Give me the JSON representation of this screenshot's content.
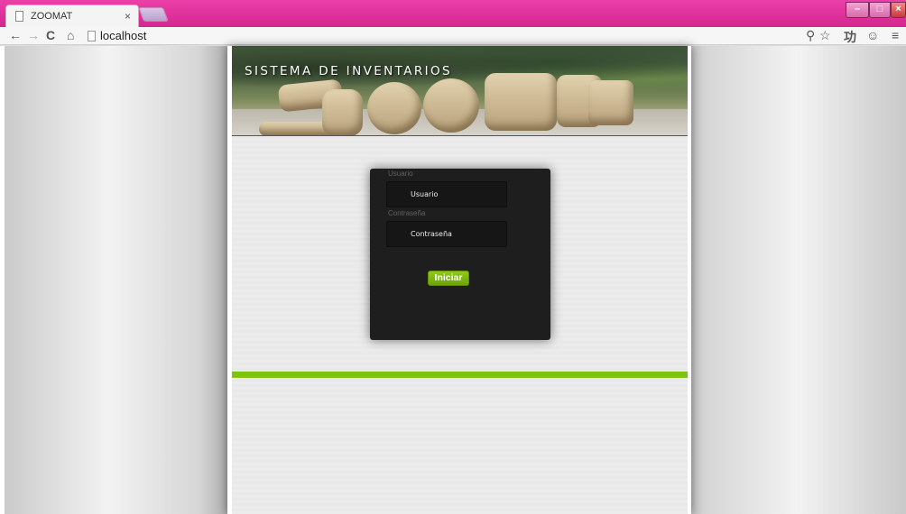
{
  "browser": {
    "tab_title": "ZOOMAT",
    "tab_close": "×",
    "url": "localhost",
    "nav": {
      "back": "←",
      "forward": "→",
      "reload": "C",
      "home": "⌂"
    },
    "toolbar_icons": {
      "zoom": "⚲",
      "star": "☆",
      "ext1": "功",
      "ext2": "☺",
      "menu": "≡"
    },
    "window_controls": {
      "minimize": "–",
      "maximize": "□",
      "close": "×"
    }
  },
  "page": {
    "site_title": "SISTEMA DE INVENTARIOS",
    "login": {
      "username_label": "Usuario",
      "username_placeholder": "Usuario",
      "password_label": "Contraseña",
      "password_placeholder": "Contraseña",
      "submit_label": "Iniciar"
    },
    "colors": {
      "accent": "#80c30f",
      "login_bg": "#1e1e1e",
      "browser_frame": "#e0309c"
    }
  }
}
